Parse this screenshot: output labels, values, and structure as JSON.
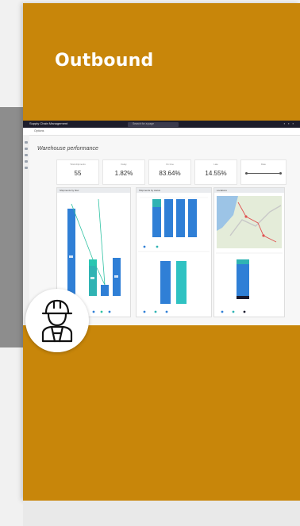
{
  "card": {
    "title": "Outbound",
    "background_color": "#c8860a"
  },
  "screenshot": {
    "app_name": "Supply Chain Management",
    "search_placeholder": "Search for a page",
    "nav_item": "Options",
    "report_title": "Warehouse performance",
    "kpis": [
      {
        "label": "Total shipments",
        "value": "55"
      },
      {
        "label": "Delay",
        "value": "1.82%"
      },
      {
        "label": "On time",
        "value": "83.64%"
      },
      {
        "label": "Late",
        "value": "14.55%"
      },
      {
        "label": "Date",
        "value": ""
      }
    ],
    "panels": [
      {
        "title": "Shipments by flow"
      },
      {
        "title": "Shipments by status"
      },
      {
        "title": "Locations"
      }
    ]
  },
  "avatar": {
    "icon": "construction-worker-icon"
  }
}
